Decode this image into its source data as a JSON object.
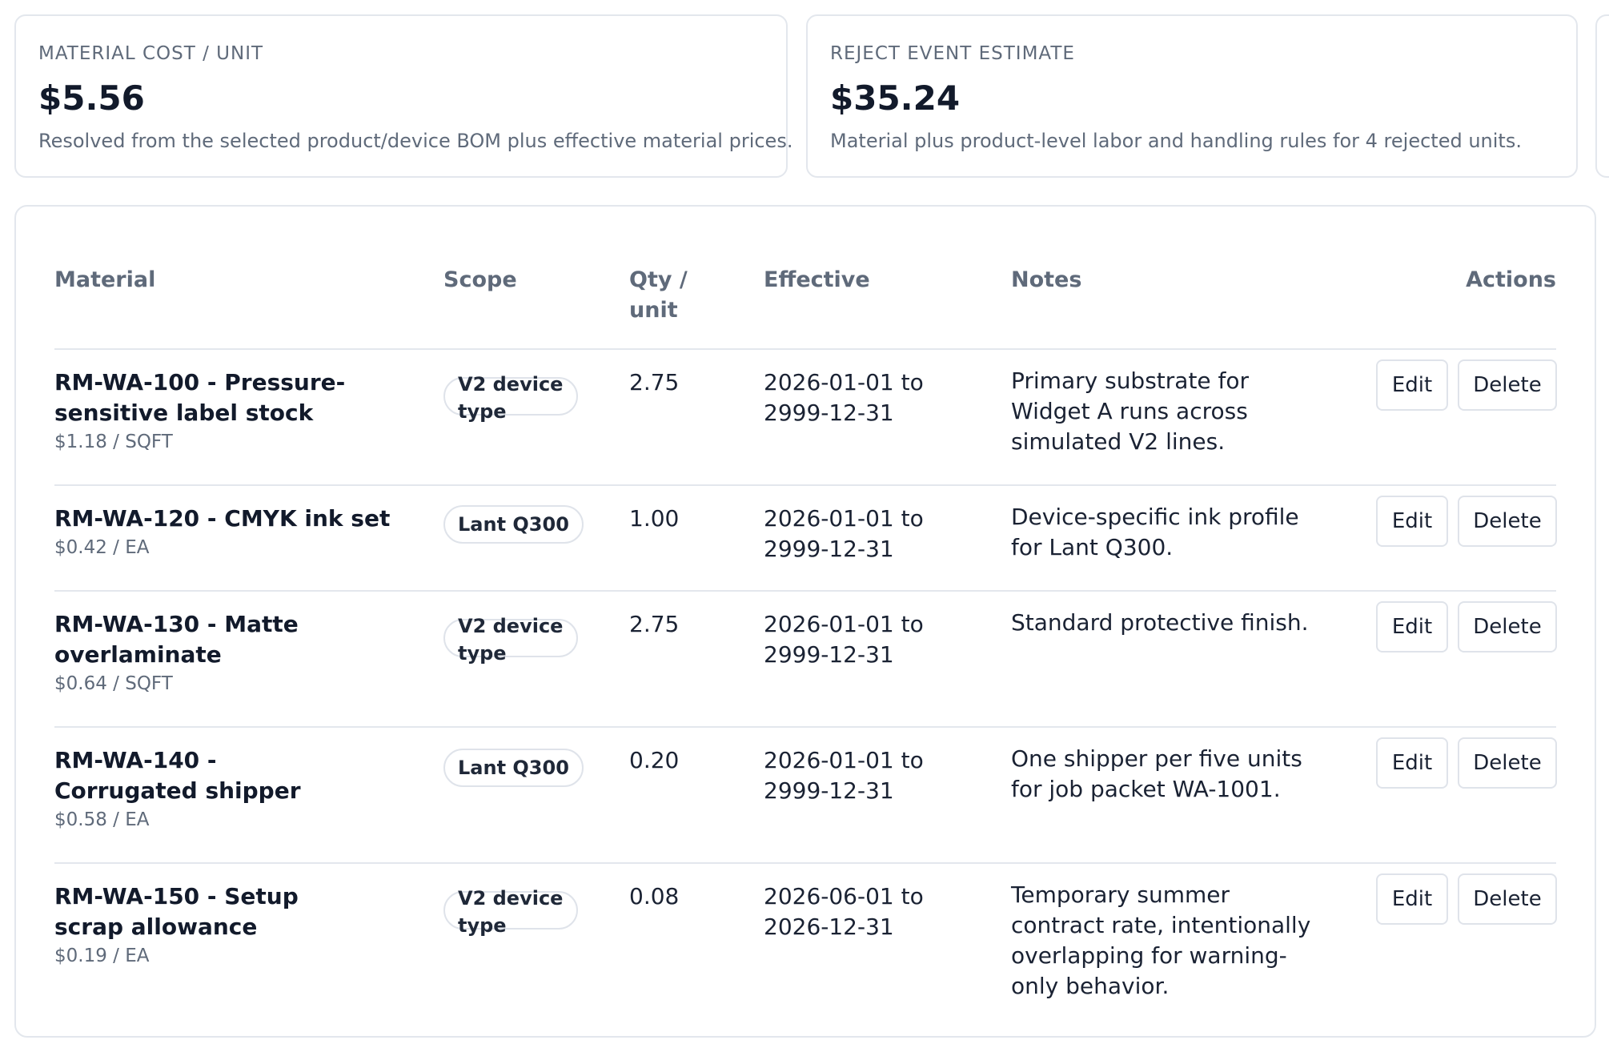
{
  "summary": {
    "material_cost": {
      "label": "MATERIAL COST / UNIT",
      "value": "$5.56",
      "description": "Resolved from the selected product/device BOM plus effective material prices."
    },
    "reject_estimate": {
      "label": "REJECT EVENT ESTIMATE",
      "value": "$35.24",
      "description": "Material plus product-level labor and handling rules for 4 rejected units."
    }
  },
  "table": {
    "headers": {
      "material": "Material",
      "scope": "Scope",
      "qty": "Qty / unit",
      "effective": "Effective",
      "notes": "Notes",
      "actions": "Actions"
    },
    "action_labels": {
      "edit": "Edit",
      "delete": "Delete"
    },
    "rows": [
      {
        "material": "RM-WA-100 - Pressure-sensitive label stock",
        "price": "$1.18 / SQFT",
        "scope": "V2 device type",
        "qty": "2.75",
        "effective": "2026-01-01 to 2999-12-31",
        "notes": "Primary substrate for Widget A runs across simulated V2 lines."
      },
      {
        "material": "RM-WA-120 - CMYK ink set",
        "price": "$0.42 / EA",
        "scope": "Lant Q300",
        "qty": "1.00",
        "effective": "2026-01-01 to 2999-12-31",
        "notes": "Device-specific ink profile for Lant Q300."
      },
      {
        "material": "RM-WA-130 - Matte overlaminate",
        "price": "$0.64 / SQFT",
        "scope": "V2 device type",
        "qty": "2.75",
        "effective": "2026-01-01 to 2999-12-31",
        "notes": "Standard protective finish."
      },
      {
        "material": "RM-WA-140 - Corrugated shipper",
        "price": "$0.58 / EA",
        "scope": "Lant Q300",
        "qty": "0.20",
        "effective": "2026-01-01 to 2999-12-31",
        "notes": "One shipper per five units for job packet WA-1001."
      },
      {
        "material": "RM-WA-150 - Setup scrap allowance",
        "price": "$0.19 / EA",
        "scope": "V2 device type",
        "qty": "0.08",
        "effective": "2026-06-01 to 2026-12-31",
        "notes": "Temporary summer contract rate, intentionally overlapping for warning-only behavior."
      }
    ]
  }
}
